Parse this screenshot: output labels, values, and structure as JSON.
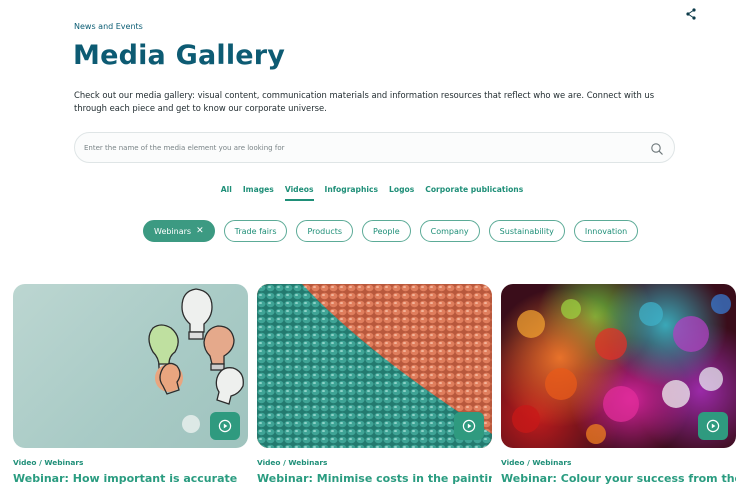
{
  "breadcrumb": "News and Events",
  "title": "Media Gallery",
  "intro": "Check out our media gallery: visual content, communication materials and information resources that reflect who we are. Connect with us through each piece and get to know our corporate universe.",
  "search": {
    "placeholder": "Enter the name of the media element you are looking for"
  },
  "tabs": [
    {
      "label": "All"
    },
    {
      "label": "Images"
    },
    {
      "label": "Videos",
      "active": true
    },
    {
      "label": "Infographics"
    },
    {
      "label": "Logos"
    },
    {
      "label": "Corporate publications"
    }
  ],
  "chips": [
    {
      "label": "Webinars",
      "active": true,
      "remove": "✕"
    },
    {
      "label": "Trade fairs"
    },
    {
      "label": "Products"
    },
    {
      "label": "People"
    },
    {
      "label": "Company"
    },
    {
      "label": "Sustainability"
    },
    {
      "label": "Innovation"
    }
  ],
  "cards": [
    {
      "meta": "Video / Webinars",
      "title": "Webinar: How important is accurate"
    },
    {
      "meta": "Video / Webinars",
      "title": "Webinar: Minimise costs in the painting"
    },
    {
      "meta": "Video / Webinars",
      "title": "Webinar: Colour your success from the start"
    }
  ],
  "colors": {
    "brand": "#0d5b73",
    "accent": "#2f9a7f"
  },
  "icons": {
    "share": "share-icon",
    "search": "search-icon",
    "play": "play-icon",
    "remove": "close-icon"
  }
}
